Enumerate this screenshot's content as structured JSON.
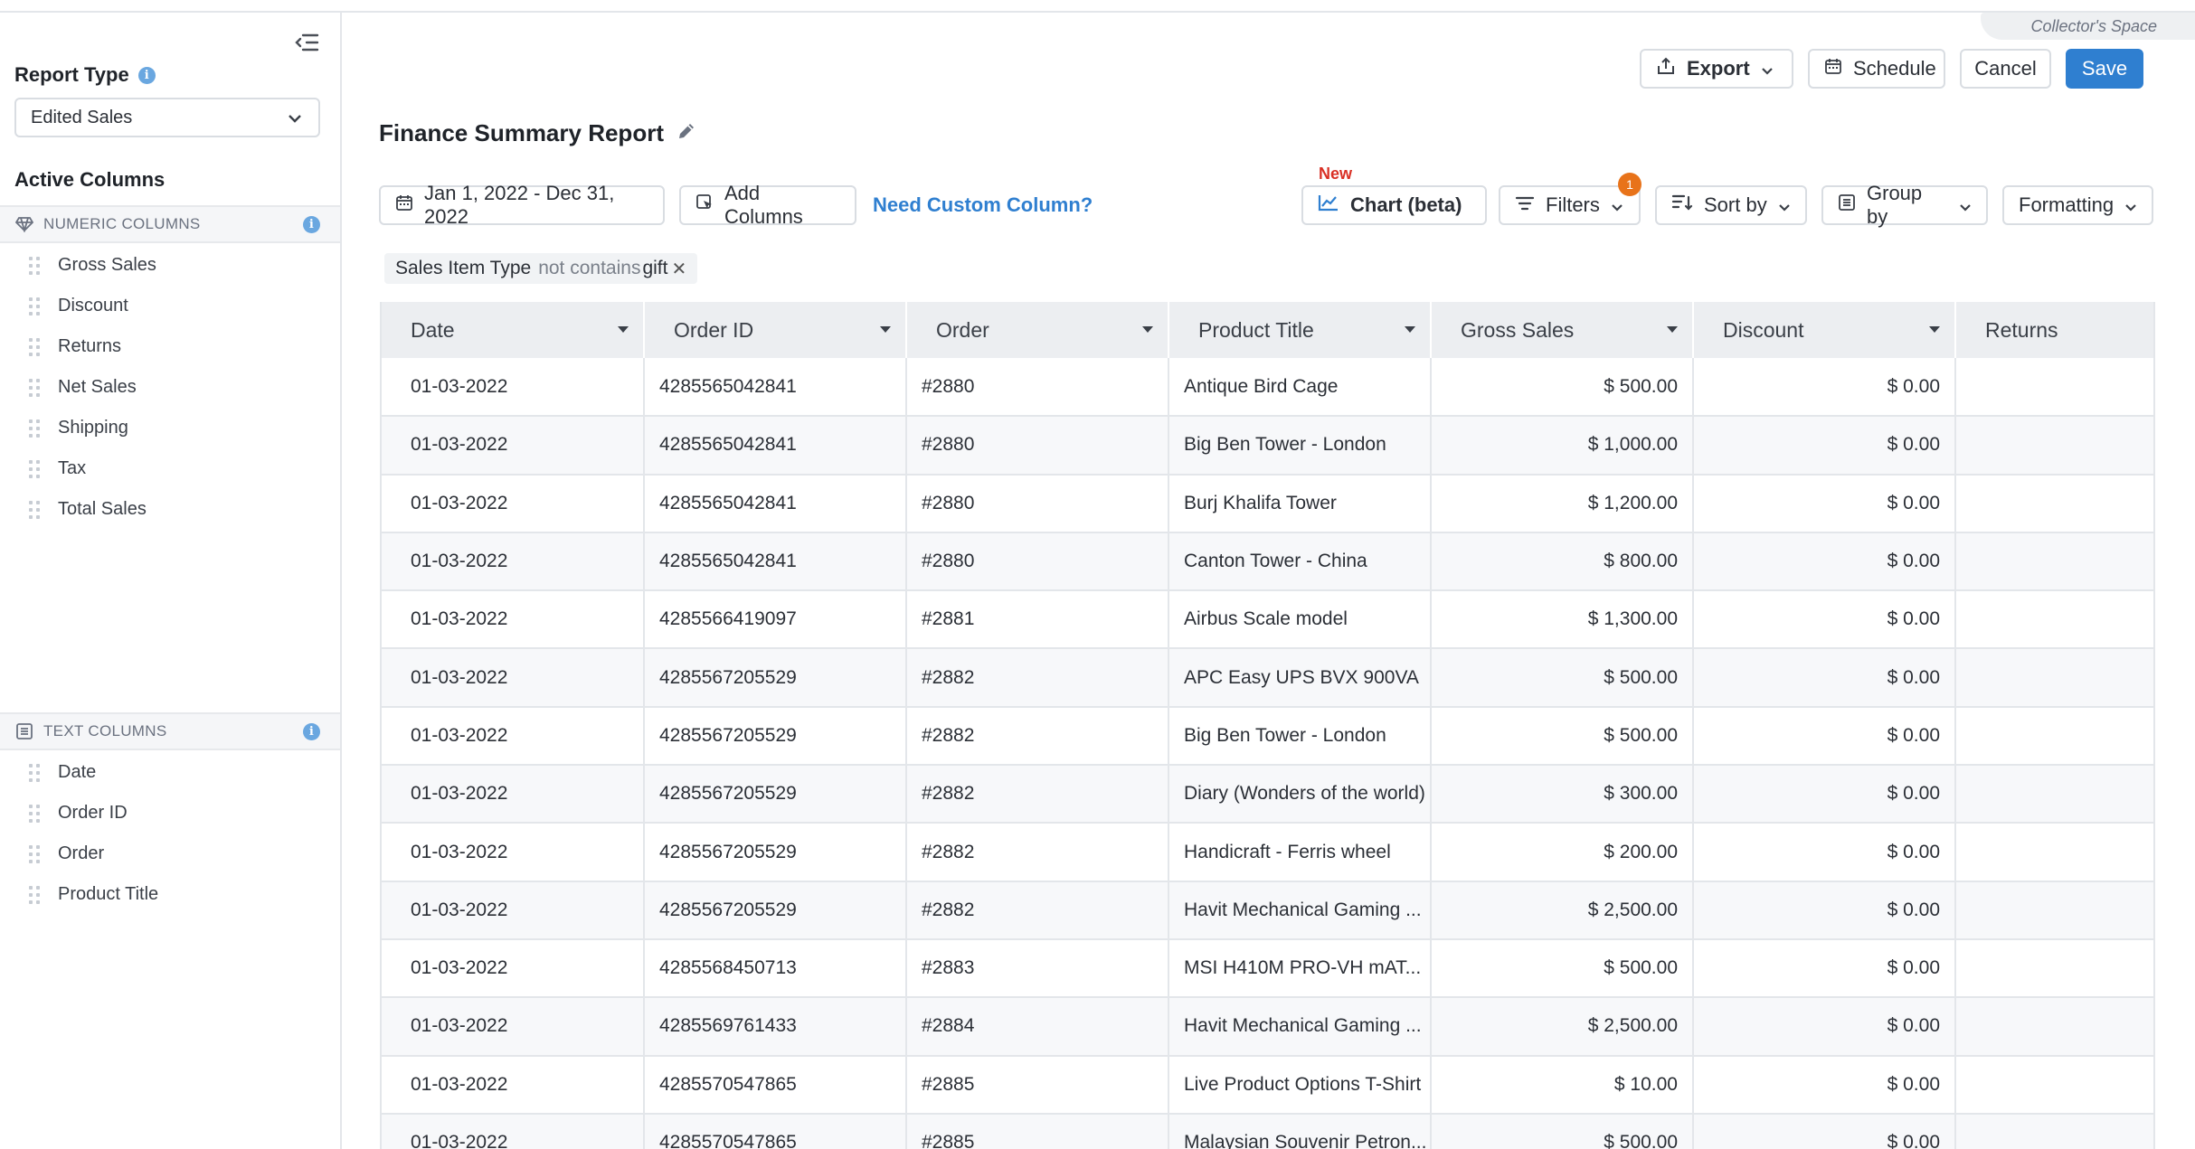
{
  "sidebar": {
    "report_type_label": "Report Type",
    "report_type_value": "Edited Sales",
    "active_columns_label": "Active Columns",
    "numeric_header": "NUMERIC COLUMNS",
    "numeric_items": [
      "Gross Sales",
      "Discount",
      "Returns",
      "Net Sales",
      "Shipping",
      "Tax",
      "Total Sales"
    ],
    "text_header": "TEXT COLUMNS",
    "text_items": [
      "Date",
      "Order ID",
      "Order",
      "Product Title"
    ]
  },
  "header": {
    "store_name": "Collector's Space",
    "export_label": "Export",
    "schedule_label": "Schedule",
    "cancel_label": "Cancel",
    "save_label": "Save",
    "title": "Finance Summary Report"
  },
  "toolbar": {
    "date_range": "Jan 1, 2022 - Dec 31, 2022",
    "add_columns": "Add Columns",
    "custom_column_link": "Need Custom Column?",
    "new_label": "New",
    "chart_label": "Chart (beta)",
    "filters_label": "Filters",
    "filters_count": "1",
    "sort_label": "Sort by",
    "group_label": "Group by",
    "formatting_label": "Formatting"
  },
  "filter_chip": {
    "field": "Sales Item Type",
    "operator": "not contains",
    "value": "gift"
  },
  "colors": {
    "primary": "#2f7fd0",
    "badge": "#e8731a",
    "new": "#d93025"
  },
  "table": {
    "columns": [
      "Date",
      "Order ID",
      "Order",
      "Product Title",
      "Gross Sales",
      "Discount",
      "Returns"
    ],
    "rows": [
      [
        "01-03-2022",
        "4285565042841",
        "#2880",
        "Antique Bird Cage",
        "$ 500.00",
        "$ 0.00",
        ""
      ],
      [
        "01-03-2022",
        "4285565042841",
        "#2880",
        "Big Ben Tower - London",
        "$ 1,000.00",
        "$ 0.00",
        ""
      ],
      [
        "01-03-2022",
        "4285565042841",
        "#2880",
        "Burj Khalifa Tower",
        "$ 1,200.00",
        "$ 0.00",
        ""
      ],
      [
        "01-03-2022",
        "4285565042841",
        "#2880",
        "Canton Tower - China",
        "$ 800.00",
        "$ 0.00",
        ""
      ],
      [
        "01-03-2022",
        "4285566419097",
        "#2881",
        "Airbus Scale model",
        "$ 1,300.00",
        "$ 0.00",
        ""
      ],
      [
        "01-03-2022",
        "4285567205529",
        "#2882",
        "APC Easy UPS BVX 900VA",
        "$ 500.00",
        "$ 0.00",
        ""
      ],
      [
        "01-03-2022",
        "4285567205529",
        "#2882",
        "Big Ben Tower - London",
        "$ 500.00",
        "$ 0.00",
        ""
      ],
      [
        "01-03-2022",
        "4285567205529",
        "#2882",
        "Diary (Wonders of the world)",
        "$ 300.00",
        "$ 0.00",
        ""
      ],
      [
        "01-03-2022",
        "4285567205529",
        "#2882",
        "Handicraft - Ferris wheel",
        "$ 200.00",
        "$ 0.00",
        ""
      ],
      [
        "01-03-2022",
        "4285567205529",
        "#2882",
        "Havit Mechanical Gaming ...",
        "$ 2,500.00",
        "$ 0.00",
        ""
      ],
      [
        "01-03-2022",
        "4285568450713",
        "#2883",
        "MSI H410M PRO-VH mAT...",
        "$ 500.00",
        "$ 0.00",
        ""
      ],
      [
        "01-03-2022",
        "4285569761433",
        "#2884",
        "Havit Mechanical Gaming ...",
        "$ 2,500.00",
        "$ 0.00",
        ""
      ],
      [
        "01-03-2022",
        "4285570547865",
        "#2885",
        "Live Product Options T-Shirt",
        "$ 10.00",
        "$ 0.00",
        ""
      ],
      [
        "01-03-2022",
        "4285570547865",
        "#2885",
        "Malaysian Souvenir Petron...",
        "$ 500.00",
        "$ 0.00",
        ""
      ]
    ]
  }
}
